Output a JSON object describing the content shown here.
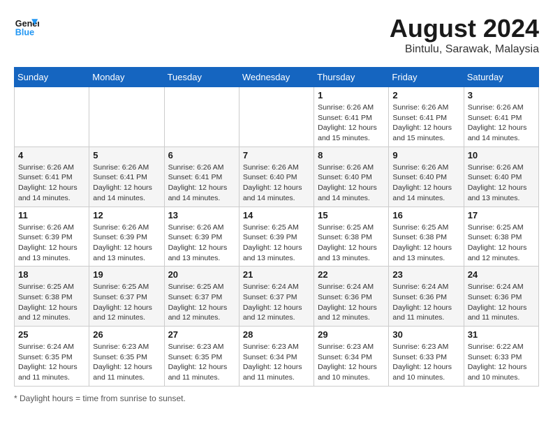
{
  "header": {
    "logo_line1": "General",
    "logo_line2": "Blue",
    "month_title": "August 2024",
    "location": "Bintulu, Sarawak, Malaysia"
  },
  "days_of_week": [
    "Sunday",
    "Monday",
    "Tuesday",
    "Wednesday",
    "Thursday",
    "Friday",
    "Saturday"
  ],
  "footer": {
    "note": "Daylight hours"
  },
  "weeks": [
    [
      {
        "day": "",
        "sunrise": "",
        "sunset": "",
        "daylight": ""
      },
      {
        "day": "",
        "sunrise": "",
        "sunset": "",
        "daylight": ""
      },
      {
        "day": "",
        "sunrise": "",
        "sunset": "",
        "daylight": ""
      },
      {
        "day": "",
        "sunrise": "",
        "sunset": "",
        "daylight": ""
      },
      {
        "day": "1",
        "sunrise": "Sunrise: 6:26 AM",
        "sunset": "Sunset: 6:41 PM",
        "daylight": "Daylight: 12 hours and 15 minutes."
      },
      {
        "day": "2",
        "sunrise": "Sunrise: 6:26 AM",
        "sunset": "Sunset: 6:41 PM",
        "daylight": "Daylight: 12 hours and 15 minutes."
      },
      {
        "day": "3",
        "sunrise": "Sunrise: 6:26 AM",
        "sunset": "Sunset: 6:41 PM",
        "daylight": "Daylight: 12 hours and 14 minutes."
      }
    ],
    [
      {
        "day": "4",
        "sunrise": "Sunrise: 6:26 AM",
        "sunset": "Sunset: 6:41 PM",
        "daylight": "Daylight: 12 hours and 14 minutes."
      },
      {
        "day": "5",
        "sunrise": "Sunrise: 6:26 AM",
        "sunset": "Sunset: 6:41 PM",
        "daylight": "Daylight: 12 hours and 14 minutes."
      },
      {
        "day": "6",
        "sunrise": "Sunrise: 6:26 AM",
        "sunset": "Sunset: 6:41 PM",
        "daylight": "Daylight: 12 hours and 14 minutes."
      },
      {
        "day": "7",
        "sunrise": "Sunrise: 6:26 AM",
        "sunset": "Sunset: 6:40 PM",
        "daylight": "Daylight: 12 hours and 14 minutes."
      },
      {
        "day": "8",
        "sunrise": "Sunrise: 6:26 AM",
        "sunset": "Sunset: 6:40 PM",
        "daylight": "Daylight: 12 hours and 14 minutes."
      },
      {
        "day": "9",
        "sunrise": "Sunrise: 6:26 AM",
        "sunset": "Sunset: 6:40 PM",
        "daylight": "Daylight: 12 hours and 14 minutes."
      },
      {
        "day": "10",
        "sunrise": "Sunrise: 6:26 AM",
        "sunset": "Sunset: 6:40 PM",
        "daylight": "Daylight: 12 hours and 13 minutes."
      }
    ],
    [
      {
        "day": "11",
        "sunrise": "Sunrise: 6:26 AM",
        "sunset": "Sunset: 6:39 PM",
        "daylight": "Daylight: 12 hours and 13 minutes."
      },
      {
        "day": "12",
        "sunrise": "Sunrise: 6:26 AM",
        "sunset": "Sunset: 6:39 PM",
        "daylight": "Daylight: 12 hours and 13 minutes."
      },
      {
        "day": "13",
        "sunrise": "Sunrise: 6:26 AM",
        "sunset": "Sunset: 6:39 PM",
        "daylight": "Daylight: 12 hours and 13 minutes."
      },
      {
        "day": "14",
        "sunrise": "Sunrise: 6:25 AM",
        "sunset": "Sunset: 6:39 PM",
        "daylight": "Daylight: 12 hours and 13 minutes."
      },
      {
        "day": "15",
        "sunrise": "Sunrise: 6:25 AM",
        "sunset": "Sunset: 6:38 PM",
        "daylight": "Daylight: 12 hours and 13 minutes."
      },
      {
        "day": "16",
        "sunrise": "Sunrise: 6:25 AM",
        "sunset": "Sunset: 6:38 PM",
        "daylight": "Daylight: 12 hours and 13 minutes."
      },
      {
        "day": "17",
        "sunrise": "Sunrise: 6:25 AM",
        "sunset": "Sunset: 6:38 PM",
        "daylight": "Daylight: 12 hours and 12 minutes."
      }
    ],
    [
      {
        "day": "18",
        "sunrise": "Sunrise: 6:25 AM",
        "sunset": "Sunset: 6:38 PM",
        "daylight": "Daylight: 12 hours and 12 minutes."
      },
      {
        "day": "19",
        "sunrise": "Sunrise: 6:25 AM",
        "sunset": "Sunset: 6:37 PM",
        "daylight": "Daylight: 12 hours and 12 minutes."
      },
      {
        "day": "20",
        "sunrise": "Sunrise: 6:25 AM",
        "sunset": "Sunset: 6:37 PM",
        "daylight": "Daylight: 12 hours and 12 minutes."
      },
      {
        "day": "21",
        "sunrise": "Sunrise: 6:24 AM",
        "sunset": "Sunset: 6:37 PM",
        "daylight": "Daylight: 12 hours and 12 minutes."
      },
      {
        "day": "22",
        "sunrise": "Sunrise: 6:24 AM",
        "sunset": "Sunset: 6:36 PM",
        "daylight": "Daylight: 12 hours and 12 minutes."
      },
      {
        "day": "23",
        "sunrise": "Sunrise: 6:24 AM",
        "sunset": "Sunset: 6:36 PM",
        "daylight": "Daylight: 12 hours and 11 minutes."
      },
      {
        "day": "24",
        "sunrise": "Sunrise: 6:24 AM",
        "sunset": "Sunset: 6:36 PM",
        "daylight": "Daylight: 12 hours and 11 minutes."
      }
    ],
    [
      {
        "day": "25",
        "sunrise": "Sunrise: 6:24 AM",
        "sunset": "Sunset: 6:35 PM",
        "daylight": "Daylight: 12 hours and 11 minutes."
      },
      {
        "day": "26",
        "sunrise": "Sunrise: 6:23 AM",
        "sunset": "Sunset: 6:35 PM",
        "daylight": "Daylight: 12 hours and 11 minutes."
      },
      {
        "day": "27",
        "sunrise": "Sunrise: 6:23 AM",
        "sunset": "Sunset: 6:35 PM",
        "daylight": "Daylight: 12 hours and 11 minutes."
      },
      {
        "day": "28",
        "sunrise": "Sunrise: 6:23 AM",
        "sunset": "Sunset: 6:34 PM",
        "daylight": "Daylight: 12 hours and 11 minutes."
      },
      {
        "day": "29",
        "sunrise": "Sunrise: 6:23 AM",
        "sunset": "Sunset: 6:34 PM",
        "daylight": "Daylight: 12 hours and 10 minutes."
      },
      {
        "day": "30",
        "sunrise": "Sunrise: 6:23 AM",
        "sunset": "Sunset: 6:33 PM",
        "daylight": "Daylight: 12 hours and 10 minutes."
      },
      {
        "day": "31",
        "sunrise": "Sunrise: 6:22 AM",
        "sunset": "Sunset: 6:33 PM",
        "daylight": "Daylight: 12 hours and 10 minutes."
      }
    ]
  ]
}
